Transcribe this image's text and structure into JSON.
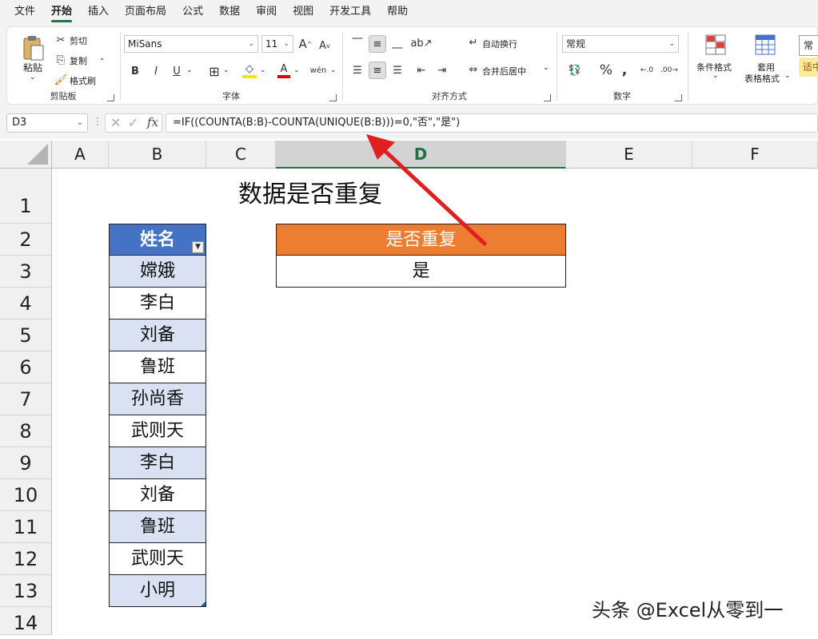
{
  "menu": [
    "文件",
    "开始",
    "插入",
    "页面布局",
    "公式",
    "数据",
    "审阅",
    "视图",
    "开发工具",
    "帮助"
  ],
  "ribbon": {
    "clipboard": {
      "paste": "粘贴",
      "cut": "剪切",
      "copy": "复制",
      "format_painter": "格式刷",
      "label": "剪贴板"
    },
    "font": {
      "name": "MiSans",
      "size": "11",
      "label": "字体",
      "bold": "B",
      "italic": "I",
      "underline": "U"
    },
    "alignment": {
      "wrap": "自动换行",
      "merge": "合并后居中",
      "label": "对齐方式"
    },
    "number": {
      "format": "常规",
      "label": "数字"
    },
    "styles": {
      "conditional": "条件格式",
      "table_format_1": "套用",
      "table_format_2": "表格格式",
      "style_1": "常规",
      "style_2": "适中"
    }
  },
  "formula_bar": {
    "name_box": "D3",
    "formula": "=IF((COUNTA(B:B)-COUNTA(UNIQUE(B:B)))=0,\"否\",\"是\")"
  },
  "columns": [
    "A",
    "B",
    "C",
    "D",
    "E",
    "F"
  ],
  "rows": [
    "1",
    "2",
    "3",
    "4",
    "5",
    "6",
    "7",
    "8",
    "9",
    "10",
    "11",
    "12",
    "13",
    "14"
  ],
  "sheet": {
    "title": "数据是否重复",
    "name_header": "姓名",
    "names": [
      "嫦娥",
      "李白",
      "刘备",
      "鲁班",
      "孙尚香",
      "武则天",
      "李白",
      "刘备",
      "鲁班",
      "武则天",
      "小明"
    ],
    "result_header": "是否重复",
    "result_value": "是"
  },
  "watermark": "头条 @Excel从零到一",
  "colors": {
    "table_header": "#4472c4",
    "band": "#d9e1f2",
    "result_header": "#ed7d31",
    "arrow": "#e02020",
    "accent": "#217346"
  }
}
